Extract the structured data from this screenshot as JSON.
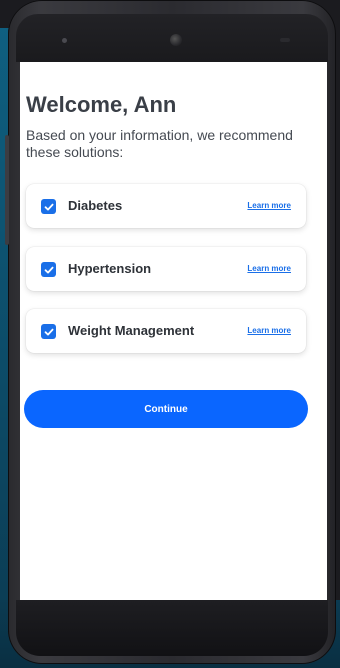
{
  "screen": {
    "title": "Welcome, Ann",
    "subtitle": "Based on your information, we recommend these solutions:"
  },
  "solutions": [
    {
      "label": "Diabetes",
      "checked": true,
      "link": "Learn more"
    },
    {
      "label": "Hypertension",
      "checked": true,
      "link": "Learn more"
    },
    {
      "label": "Weight Management",
      "checked": true,
      "link": "Learn more"
    }
  ],
  "continue_label": "Continue",
  "colors": {
    "accent": "#0a66ff",
    "checkbox": "#1a6fe8",
    "title_text": "#3a3f47"
  },
  "icons": {
    "checkbox": "checkmark-icon",
    "camera": "front-camera-icon"
  }
}
